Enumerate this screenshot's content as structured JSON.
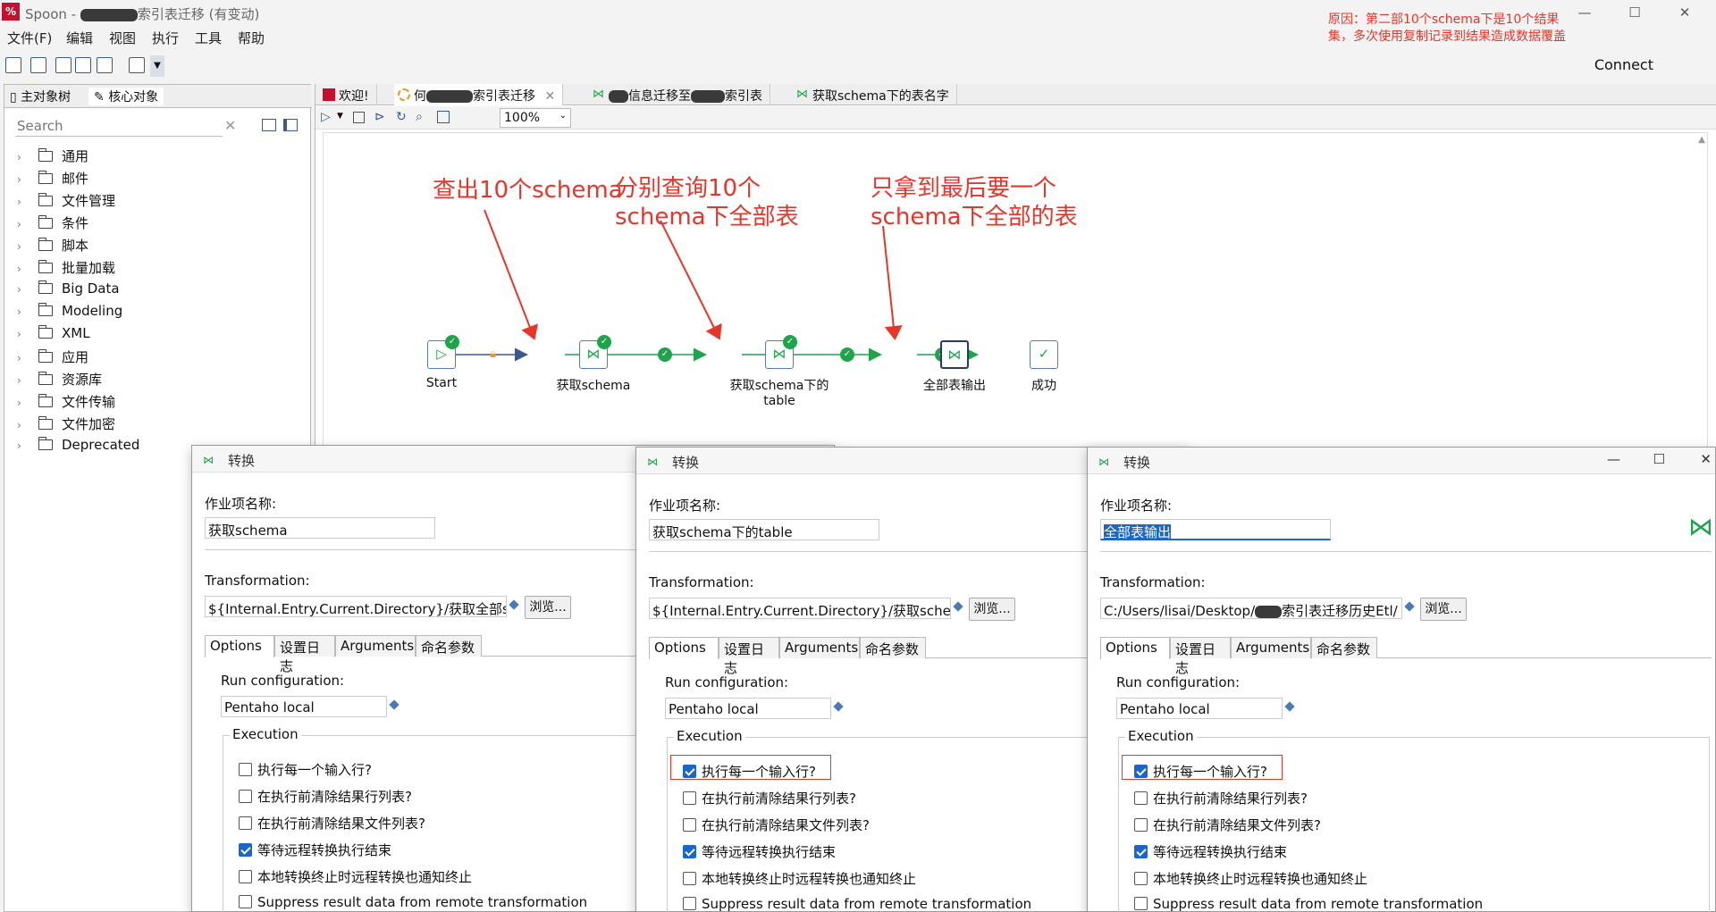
{
  "window": {
    "app": "Spoon - ",
    "title_suffix": "索引表迁移 (有变动)",
    "controls": {
      "minimize": "—",
      "maximize": "☐",
      "close": "✕"
    }
  },
  "note": "原因：第二部10个schema下是10个结果集，多次使用复制记录到结果造成数据覆盖",
  "menu": [
    "文件(F)",
    "编辑",
    "视图",
    "执行",
    "工具",
    "帮助"
  ],
  "toolbar": {
    "connect": "Connect"
  },
  "left_panel": {
    "tabs": [
      "主对象树",
      "核心对象"
    ],
    "search_placeholder": "Search",
    "tree": [
      "通用",
      "邮件",
      "文件管理",
      "条件",
      "脚本",
      "批量加载",
      "Big Data",
      "Modeling",
      "XML",
      "应用",
      "资源库",
      "文件传输",
      "文件加密",
      "Deprecated"
    ]
  },
  "editor": {
    "tabs": [
      {
        "label": "欢迎!",
        "icon": "spoon-icon"
      },
      {
        "label": "索引表迁移",
        "prefix": "何",
        "icon": "job-icon",
        "closable": "✕"
      },
      {
        "label": "信息迁移至",
        "suffix": "索引表",
        "icon": "transform-icon"
      },
      {
        "label": "获取schema下的表名字",
        "icon": "transform-icon"
      }
    ],
    "zoom": "100%"
  },
  "annotations": [
    {
      "text": "查出10个schema"
    },
    {
      "text": "分别查询10个schema下全部表"
    },
    {
      "text": "只拿到最后要一个schema下全部的表"
    }
  ],
  "nodes": [
    {
      "label": "Start"
    },
    {
      "label": "获取schema"
    },
    {
      "label": "获取schema下的table"
    },
    {
      "label": "全部表输出"
    },
    {
      "label": "成功"
    }
  ],
  "dialogs": [
    {
      "title": "转换",
      "job_name_label": "作业项名称:",
      "job_name": "获取schema",
      "transformation_label": "Transformation:",
      "transformation_path": "${Internal.Entry.Current.Directory}/获取全部scl",
      "browse": "浏览...",
      "tabs": [
        "Options",
        "设置日志",
        "Arguments",
        "命名参数"
      ],
      "run_config_label": "Run configuration:",
      "run_config": "Pentaho local",
      "execution_label": "Execution",
      "checkboxes": [
        {
          "label": "执行每一个输入行?",
          "checked": false
        },
        {
          "label": "在执行前清除结果行列表?",
          "checked": false
        },
        {
          "label": "在执行前清除结果文件列表?",
          "checked": false
        },
        {
          "label": "等待远程转换执行结束",
          "checked": true
        },
        {
          "label": "本地转换终止时远程转换也通知终止",
          "checked": false
        },
        {
          "label": "Suppress result data from remote transformation",
          "checked": false
        }
      ]
    },
    {
      "title": "转换",
      "job_name_label": "作业项名称:",
      "job_name": "获取schema下的table",
      "transformation_label": "Transformation:",
      "transformation_path": "${Internal.Entry.Current.Directory}/获取schem",
      "browse": "浏览...",
      "tabs": [
        "Options",
        "设置日志",
        "Arguments",
        "命名参数"
      ],
      "run_config_label": "Run configuration:",
      "run_config": "Pentaho local",
      "execution_label": "Execution",
      "checkboxes": [
        {
          "label": "执行每一个输入行?",
          "checked": true
        },
        {
          "label": "在执行前清除结果行列表?",
          "checked": false
        },
        {
          "label": "在执行前清除结果文件列表?",
          "checked": false
        },
        {
          "label": "等待远程转换执行结束",
          "checked": true
        },
        {
          "label": "本地转换终止时远程转换也通知终止",
          "checked": false
        },
        {
          "label": "Suppress result data from remote transformation",
          "checked": false
        }
      ]
    },
    {
      "title": "转换",
      "job_name_label": "作业项名称:",
      "job_name": "全部表输出",
      "transformation_label": "Transformation:",
      "transformation_path": "C:/Users/lisai/Desktop/",
      "transformation_path_suffix": "索引表迁移历史Etl/",
      "browse": "浏览...",
      "tabs": [
        "Options",
        "设置日志",
        "Arguments",
        "命名参数"
      ],
      "run_config_label": "Run configuration:",
      "run_config": "Pentaho local",
      "execution_label": "Execution",
      "checkboxes": [
        {
          "label": "执行每一个输入行?",
          "checked": true
        },
        {
          "label": "在执行前清除结果行列表?",
          "checked": false
        },
        {
          "label": "在执行前清除结果文件列表?",
          "checked": false
        },
        {
          "label": "等待远程转换执行结束",
          "checked": true
        },
        {
          "label": "本地转换终止时远程转换也通知终止",
          "checked": false
        },
        {
          "label": "Suppress result data from remote transformation",
          "checked": false
        }
      ]
    }
  ]
}
